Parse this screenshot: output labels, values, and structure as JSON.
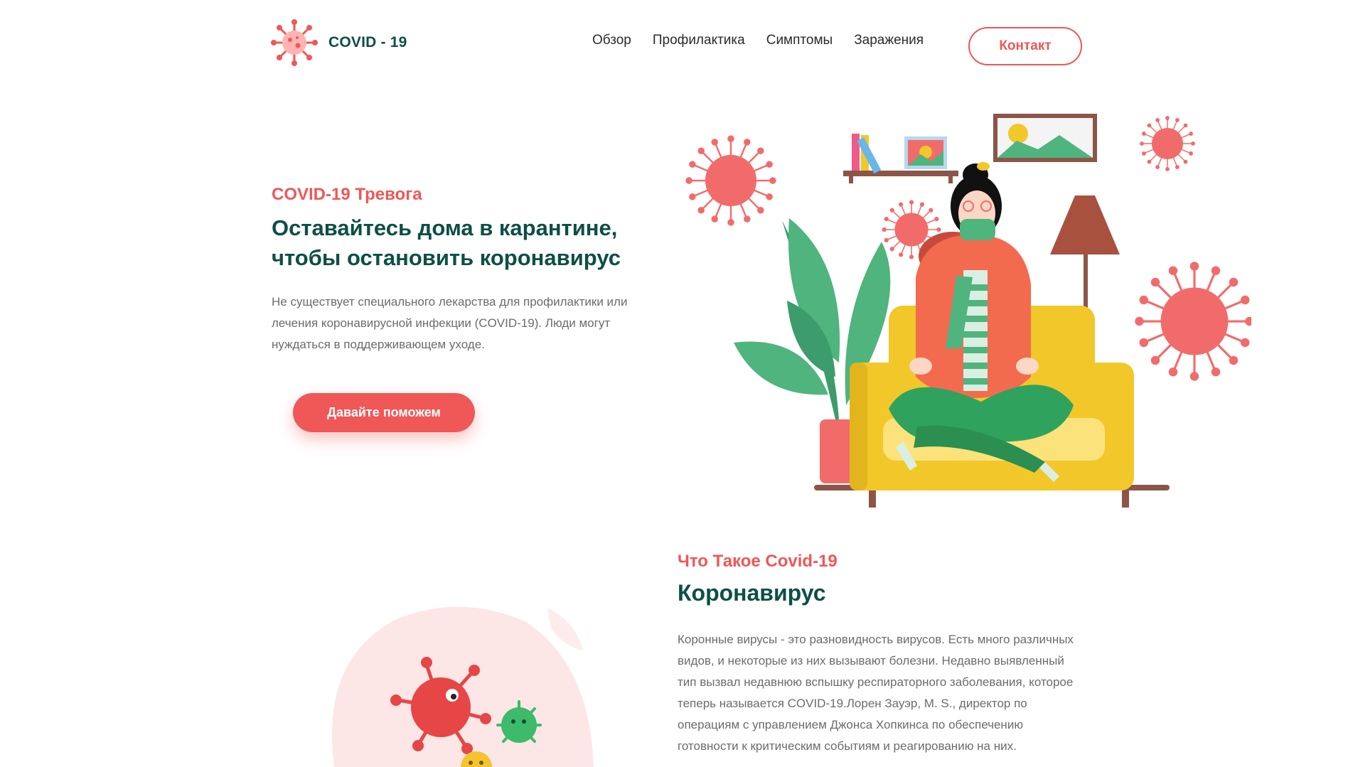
{
  "brand": {
    "name": "COVID - 19",
    "logo_icon": "virus-icon"
  },
  "nav": {
    "items": [
      {
        "label": "Обзор"
      },
      {
        "label": "Профилактика"
      },
      {
        "label": "Симптомы"
      },
      {
        "label": "Заражения"
      }
    ],
    "contact_label": "Контакт"
  },
  "hero": {
    "eyebrow": "COVID-19 Тревога",
    "title": "Оставайтесь дома в карантине, чтобы остановить коронавирус",
    "text": "Не существует специального лекарства для профилактики или лечения коронавирусной инфекции (COVID-19). Люди могут нуждаться в поддерживающем уходе.",
    "button_label": "Давайте поможем"
  },
  "about": {
    "eyebrow": "Что Такое Covid-19",
    "title": "Коронавирус",
    "text": "Коронные вирусы - это разновидность вирусов. Есть много различных видов, и некоторые из них вызывают болезни. Недавно выявленный тип вызвал недавнюю вспышку респираторного заболевания, которое теперь называется COVID-19.Лорен Зауэр, М. S., директор по операциям с управлением Джонса Хопкинса по обеспечению готовности к критическим событиям и реагированию на них."
  },
  "colors": {
    "accent": "#f05757",
    "brand_dark": "#0d4f45",
    "sofa": "#f2c72a",
    "leaf": "#4fb47e"
  }
}
